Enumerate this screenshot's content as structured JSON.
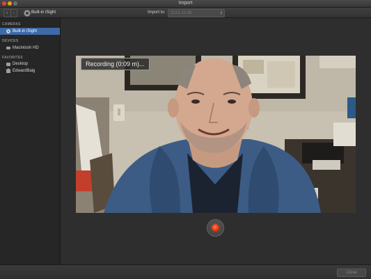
{
  "window": {
    "title": "Import"
  },
  "toolbar": {
    "back_icon": "‹",
    "forward_icon": "›",
    "source_label": "Built-in iSight",
    "import_to_label": "Import to:",
    "import_to_value": "2013-11-08"
  },
  "sidebar": {
    "cameras_header": "CAMERAS",
    "cameras": [
      {
        "label": "Built-in iSight",
        "selected": true
      }
    ],
    "devices_header": "DEVICES",
    "devices": [
      {
        "label": "Macintosh HD"
      }
    ],
    "favorites_header": "FAVORITES",
    "favorites": [
      {
        "label": "Desktop"
      },
      {
        "label": "EdwardBaig"
      }
    ]
  },
  "preview": {
    "recording_status": "Recording (0:09 m)..."
  },
  "footer": {
    "close_label": "Close"
  },
  "colors": {
    "selection": "#3d6aa8",
    "record": "#e0300a"
  }
}
